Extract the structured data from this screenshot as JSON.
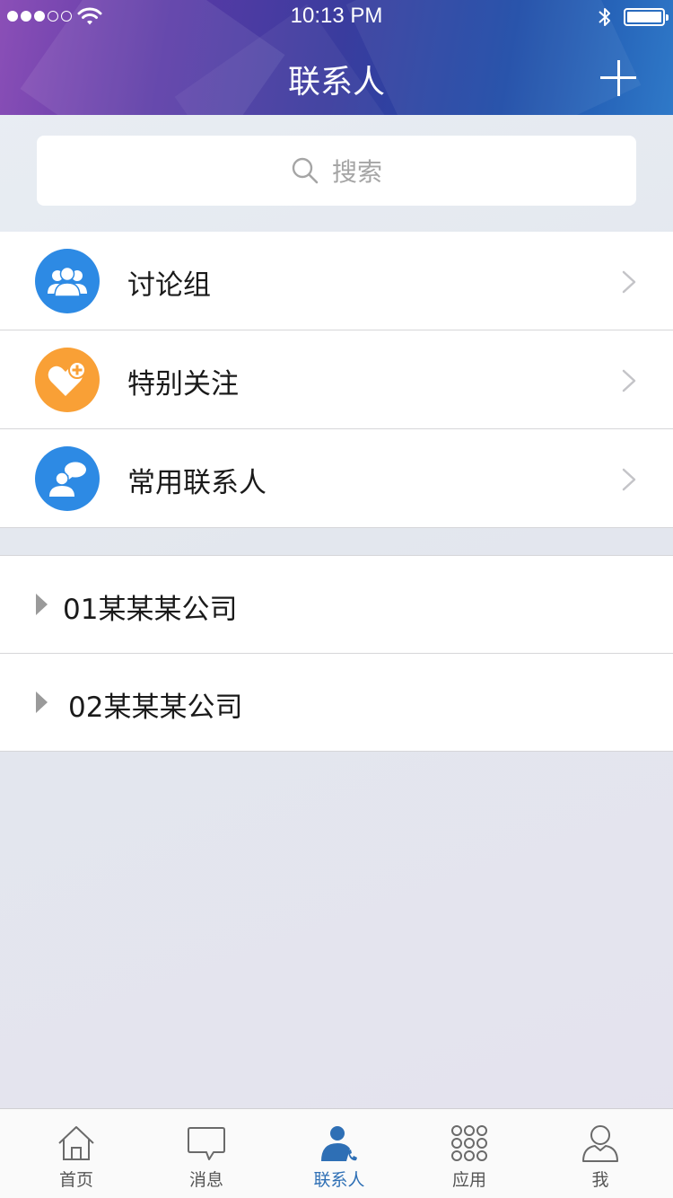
{
  "status_bar": {
    "time": "10:13 PM"
  },
  "nav": {
    "title": "联系人"
  },
  "search": {
    "placeholder": "搜索"
  },
  "menu": [
    {
      "label": "讨论组",
      "icon": "group-icon",
      "color": "#2d8ae4"
    },
    {
      "label": "特别关注",
      "icon": "heart-plus-icon",
      "color": "#f9a036"
    },
    {
      "label": "常用联系人",
      "icon": "contact-chat-icon",
      "color": "#2d8ae4"
    }
  ],
  "companies": [
    {
      "label": "01某某某公司"
    },
    {
      "label": "02某某某公司"
    }
  ],
  "tabs": [
    {
      "label": "首页",
      "icon": "home-icon"
    },
    {
      "label": "消息",
      "icon": "message-icon"
    },
    {
      "label": "联系人",
      "icon": "contacts-icon",
      "active": true
    },
    {
      "label": "应用",
      "icon": "apps-grid-icon"
    },
    {
      "label": "我",
      "icon": "profile-icon"
    }
  ],
  "colors": {
    "accent": "#2e6fb5",
    "header_start": "#8b4fb7",
    "header_end": "#2f79c8"
  }
}
